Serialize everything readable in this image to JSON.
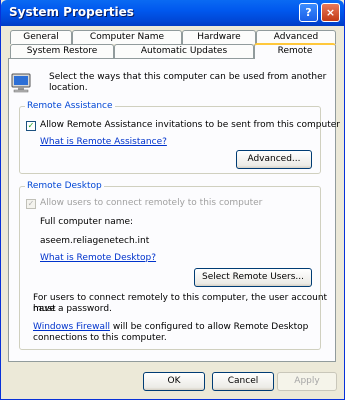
{
  "window": {
    "title": "System Properties"
  },
  "titlebar_buttons": {
    "help": "?",
    "close": "×"
  },
  "tabs_row1": [
    "General",
    "Computer Name",
    "Hardware",
    "Advanced"
  ],
  "tabs_row2": [
    "System Restore",
    "Automatic Updates",
    "Remote"
  ],
  "active_tab": "Remote",
  "intro_text_line1": "Select the ways that this computer can be used from another",
  "intro_text_line2": "location.",
  "remote_assistance": {
    "group_label": "Remote Assistance",
    "checkbox_label": "Allow Remote Assistance invitations to be sent from this computer",
    "checked": true,
    "link": "What is Remote Assistance?",
    "advanced_button": "Advanced..."
  },
  "remote_desktop": {
    "group_label": "Remote Desktop",
    "checkbox_label": "Allow users to connect remotely to this computer",
    "checked": true,
    "enabled": false,
    "full_computer_name_label": "Full computer name:",
    "full_computer_name_value": "aseem.reliagenetech.int",
    "link": "What is Remote Desktop?",
    "select_users_button": "Select Remote Users...",
    "password_note_line1": "For users to connect remotely to this computer, the user account must",
    "password_note_line2": "have a password.",
    "firewall_link": "Windows Firewall",
    "firewall_text_line1": " will be configured to allow Remote Desktop",
    "firewall_text_line2": "connections to this computer."
  },
  "footer": {
    "ok": "OK",
    "cancel": "Cancel",
    "apply": "Apply"
  },
  "colors": {
    "titlebar": "#0058ee",
    "group_label": "#0046d5",
    "link": "#0033cc",
    "active_tab_highlight": "#ffc83c"
  }
}
